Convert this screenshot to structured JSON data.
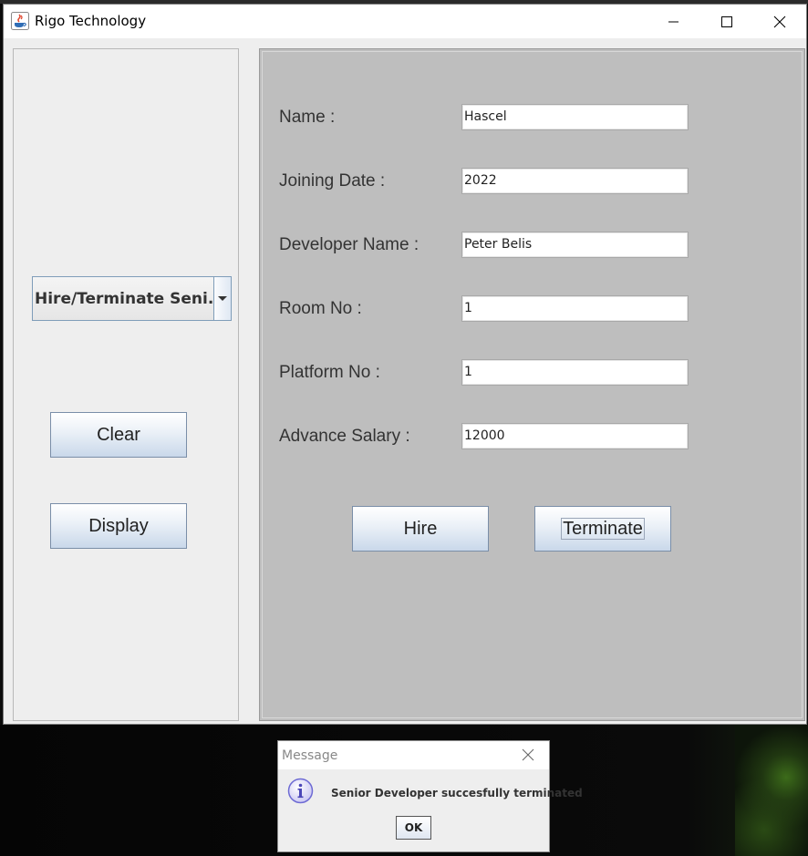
{
  "window": {
    "title": "Rigo Technology",
    "app_icon": "java-cup-icon"
  },
  "left_panel": {
    "combo_selected": "Hire/Terminate Seni...",
    "clear_label": "Clear",
    "display_label": "Display"
  },
  "form": {
    "fields": [
      {
        "label": "Name :",
        "value": "Hascel"
      },
      {
        "label": "Joining Date :",
        "value": "2022"
      },
      {
        "label": "Developer Name :",
        "value": "Peter Belis"
      },
      {
        "label": "Room No :",
        "value": "1"
      },
      {
        "label": "Platform No :",
        "value": "1"
      },
      {
        "label": "Advance Salary :",
        "value": "12000"
      }
    ],
    "hire_label": "Hire",
    "terminate_label": "Terminate"
  },
  "dialog": {
    "title": "Message",
    "message": "Senior Developer succesfully terminated",
    "ok_label": "OK",
    "icon": "info-icon"
  },
  "colors": {
    "form_background": "#bebebe",
    "button_gradient_bottom": "#c9d8ea",
    "info_icon": "#6d6ad4"
  }
}
